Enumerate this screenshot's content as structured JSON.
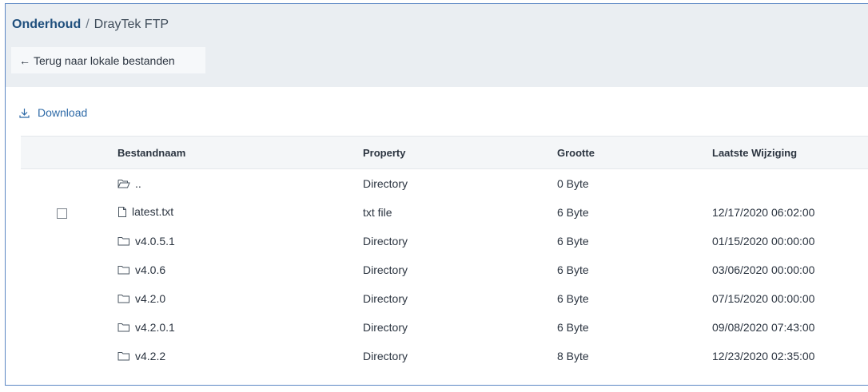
{
  "breadcrumb": {
    "root": "Onderhoud",
    "separator": "/",
    "current": "DrayTek FTP"
  },
  "back_button": {
    "label": "Terug naar lokale bestanden",
    "icon": "arrow-left-icon"
  },
  "toolbar": {
    "download_label": "Download",
    "download_icon": "download-icon"
  },
  "table": {
    "headers": {
      "name": "Bestandnaam",
      "property": "Property",
      "size": "Grootte",
      "modified": "Laatste Wijziging"
    },
    "rows": [
      {
        "icon": "folder-open-icon",
        "checkbox": false,
        "name": "..",
        "property": "Directory",
        "size": "0 Byte",
        "modified": ""
      },
      {
        "icon": "file-icon",
        "checkbox": true,
        "name": "latest.txt",
        "property": "txt file",
        "size": "6 Byte",
        "modified": "12/17/2020 06:02:00"
      },
      {
        "icon": "folder-icon",
        "checkbox": false,
        "name": "v4.0.5.1",
        "property": "Directory",
        "size": "6 Byte",
        "modified": "01/15/2020 00:00:00"
      },
      {
        "icon": "folder-icon",
        "checkbox": false,
        "name": "v4.0.6",
        "property": "Directory",
        "size": "6 Byte",
        "modified": "03/06/2020 00:00:00"
      },
      {
        "icon": "folder-icon",
        "checkbox": false,
        "name": "v4.2.0",
        "property": "Directory",
        "size": "6 Byte",
        "modified": "07/15/2020 00:00:00"
      },
      {
        "icon": "folder-icon",
        "checkbox": false,
        "name": "v4.2.0.1",
        "property": "Directory",
        "size": "6 Byte",
        "modified": "09/08/2020 07:43:00"
      },
      {
        "icon": "folder-icon",
        "checkbox": false,
        "name": "v4.2.2",
        "property": "Directory",
        "size": "8 Byte",
        "modified": "12/23/2020 02:35:00"
      }
    ]
  },
  "colors": {
    "accent": "#2e6aa7",
    "breadcrumb_root": "#1f4f7d",
    "header_bg": "#eaeef2",
    "frame_border": "#5b87c4"
  }
}
